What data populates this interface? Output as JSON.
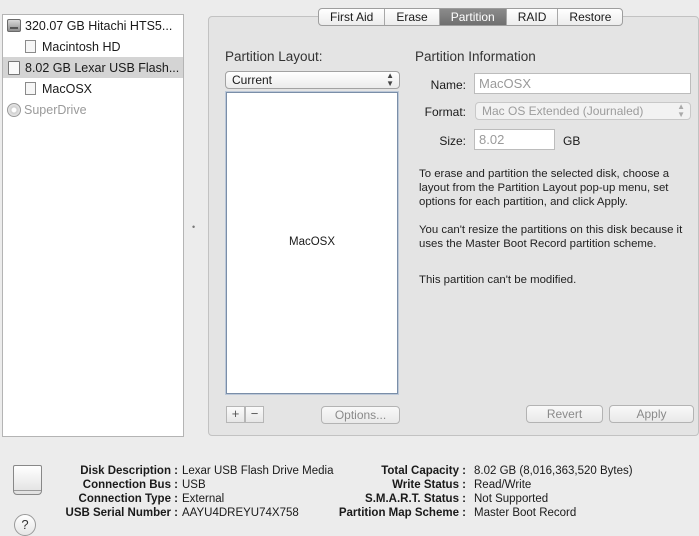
{
  "sidebar": {
    "items": [
      {
        "label": "320.07 GB Hitachi HTS5...",
        "icon": "internal-disk-icon",
        "level": 0,
        "selected": false,
        "dim": false
      },
      {
        "label": "Macintosh HD",
        "icon": "volume-icon",
        "level": 1,
        "selected": false,
        "dim": false
      },
      {
        "label": "8.02 GB Lexar USB Flash...",
        "icon": "usb-drive-icon",
        "level": 0,
        "selected": true,
        "dim": false
      },
      {
        "label": "MacOSX",
        "icon": "volume-icon",
        "level": 1,
        "selected": false,
        "dim": false
      },
      {
        "label": "SuperDrive",
        "icon": "optical-drive-icon",
        "level": 0,
        "selected": false,
        "dim": true
      }
    ]
  },
  "tabs": [
    {
      "label": "First Aid",
      "active": false
    },
    {
      "label": "Erase",
      "active": false
    },
    {
      "label": "Partition",
      "active": true
    },
    {
      "label": "RAID",
      "active": false
    },
    {
      "label": "Restore",
      "active": false
    }
  ],
  "layout": {
    "title": "Partition Layout:",
    "selected": "Current",
    "partition_name": "MacOSX",
    "add_label": "+",
    "remove_label": "−",
    "options_label": "Options..."
  },
  "info": {
    "title": "Partition Information",
    "name_label": "Name:",
    "name_value": "MacOSX",
    "format_label": "Format:",
    "format_value": "Mac OS Extended (Journaled)",
    "size_label": "Size:",
    "size_value": "8.02",
    "size_unit": "GB",
    "help_text": "To erase and partition the selected disk, choose a layout from the Partition Layout pop-up menu, set options for each partition, and click Apply.",
    "resize_text": "You can't resize the partitions on this disk because it uses the Master Boot Record partition scheme.",
    "modify_text": "This partition can't be modified.",
    "revert_label": "Revert",
    "apply_label": "Apply"
  },
  "details": {
    "left": [
      {
        "key": "Disk Description :",
        "value": "Lexar USB Flash Drive Media"
      },
      {
        "key": "Connection Bus :",
        "value": "USB"
      },
      {
        "key": "Connection Type :",
        "value": "External"
      },
      {
        "key": "USB Serial Number :",
        "value": "AAYU4DREYU74X758"
      }
    ],
    "right": [
      {
        "key": "Total Capacity :",
        "value": "8.02 GB (8,016,363,520 Bytes)"
      },
      {
        "key": "Write Status :",
        "value": "Read/Write"
      },
      {
        "key": "S.M.A.R.T. Status :",
        "value": "Not Supported"
      },
      {
        "key": "Partition Map Scheme :",
        "value": "Master Boot Record"
      }
    ]
  },
  "help_label": "?",
  "colors": {
    "selected_row": "#d4d4d4",
    "active_tab": "#7a7a7a",
    "panel": "#e4e4e4"
  }
}
